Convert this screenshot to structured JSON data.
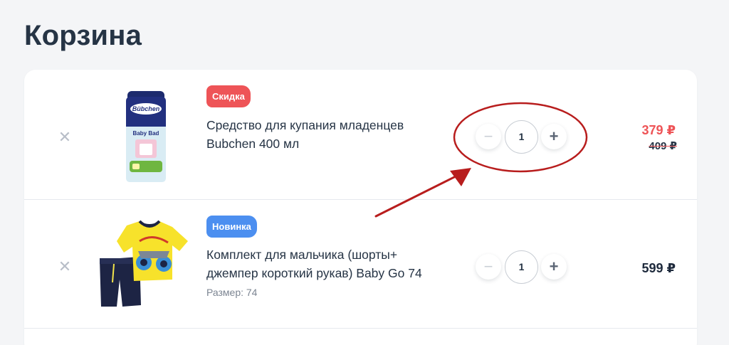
{
  "page": {
    "title": "Корзина"
  },
  "colors": {
    "sale": "#ee5457",
    "new": "#4c8ff0",
    "annotation": "#b81d1d"
  },
  "cart": {
    "items": [
      {
        "badge": "Скидка",
        "name_line1": "Средство для купания младенцев",
        "name_line2": "Bubchen 400 мл",
        "image_icon": "baby-bath-bottle-icon",
        "image_brand": "Bübchen",
        "image_label": "Baby Bad",
        "quantity": "1",
        "qty_minus": "−",
        "qty_plus": "+",
        "remove": "✕",
        "price": "379 ₽",
        "old_price": "409 ₽"
      },
      {
        "badge": "Новинка",
        "name_line1": "Комплект для мальчика (шорты+",
        "name_line2": "джемпер короткий рукав) Baby Go 74",
        "size": "Размер: 74",
        "image_icon": "kids-clothing-set-icon",
        "quantity": "1",
        "qty_minus": "−",
        "qty_plus": "+",
        "remove": "✕",
        "price": "599 ₽"
      }
    ]
  }
}
